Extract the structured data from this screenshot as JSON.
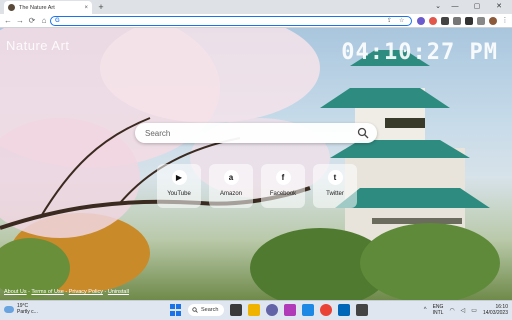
{
  "browser": {
    "tab_title": "The Nature Art",
    "tab_close": "×",
    "new_tab": "+",
    "window_controls": {
      "collapse": "⌄",
      "minimize": "—",
      "maximize": "▢",
      "close": "✕"
    },
    "nav": {
      "back": "←",
      "forward": "→",
      "reload": "⟳",
      "home": "⌂"
    },
    "omnibox_value": "G",
    "omnibox_icons": {
      "share": "⇪",
      "bookmark": "☆"
    }
  },
  "page": {
    "brand": "Nature Art",
    "clock": "04:10:27 PM",
    "search": {
      "placeholder": "Search"
    },
    "shortcuts": [
      {
        "label": "YouTube",
        "glyph": "▶"
      },
      {
        "label": "Amazon",
        "glyph": "a"
      },
      {
        "label": "Facebook",
        "glyph": "f"
      },
      {
        "label": "Twitter",
        "glyph": "t"
      }
    ],
    "footer": {
      "about": "About Us",
      "terms": "Terms of Use",
      "privacy": "Privacy Policy",
      "uninstall": "Uninstall",
      "sep": " - "
    }
  },
  "taskbar": {
    "weather_temp": "19°C",
    "weather_desc": "Partly c...",
    "search_label": "Search",
    "lang_top": "ENG",
    "lang_bottom": "INTL",
    "time": "16:10",
    "date": "14/03/2023"
  },
  "colors": {
    "accent": "#1a73e8",
    "omnibox_border": "#1a73e8",
    "teal_roof": "#2e8b80"
  }
}
